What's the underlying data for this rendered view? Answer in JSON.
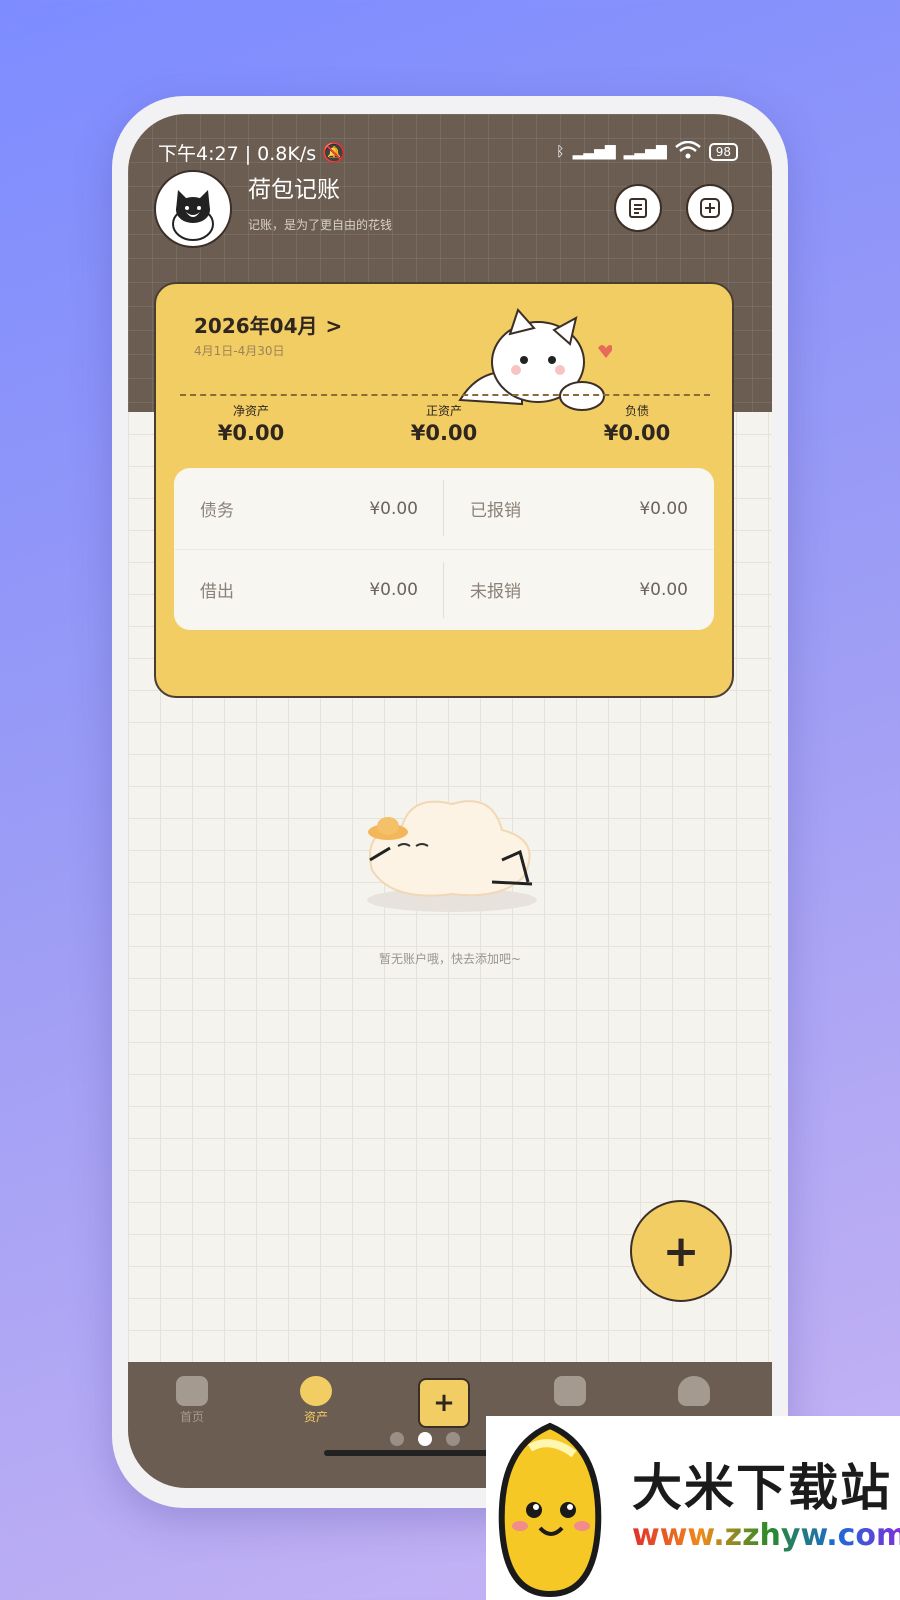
{
  "status_bar": {
    "time": "下午4:27 | 0.8K/s",
    "battery": "98"
  },
  "header": {
    "title": "荷包记账",
    "subtitle": "记账，是为了更自由的花钱"
  },
  "summary": {
    "month": "2026年04月",
    "range": "4月1日-4月30日",
    "stats": [
      {
        "label": "净资产",
        "value": "¥0.00"
      },
      {
        "label": "正资产",
        "value": "¥0.00"
      },
      {
        "label": "负债",
        "value": "¥0.00"
      }
    ],
    "details": [
      {
        "label": "债务",
        "value": "¥0.00"
      },
      {
        "label": "已报销",
        "value": "¥0.00"
      },
      {
        "label": "借出",
        "value": "¥0.00"
      },
      {
        "label": "未报销",
        "value": "¥0.00"
      }
    ]
  },
  "empty": {
    "text": "暂无账户哦，快去添加吧~"
  },
  "fab": {
    "label": "+"
  },
  "tabbar": {
    "tabs": [
      {
        "label": "首页"
      },
      {
        "label": "资产"
      },
      {
        "label": ""
      },
      {
        "label": ""
      }
    ],
    "add_label": "+"
  },
  "watermark": {
    "title": "大米下载站",
    "url": "www.zzhyw.com"
  },
  "colors": {
    "header_brown": "#6b5d52",
    "accent_yellow": "#f2cd63"
  }
}
